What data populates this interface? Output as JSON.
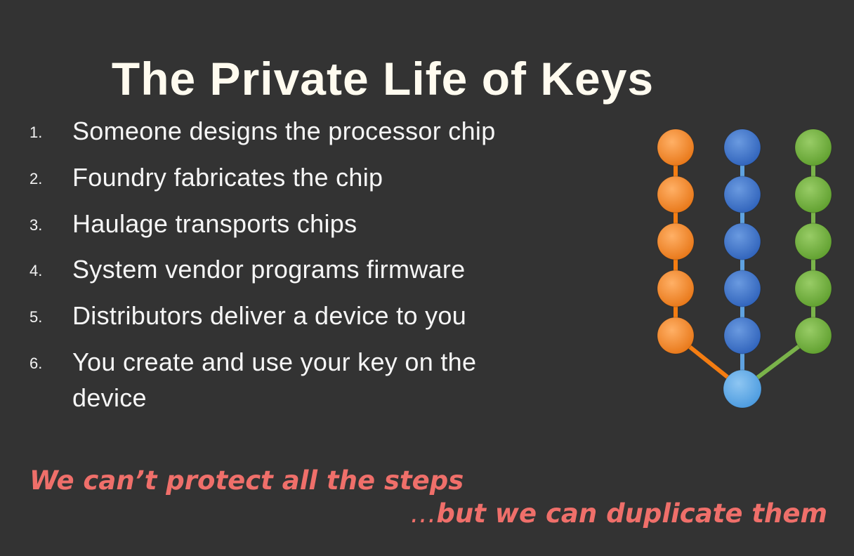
{
  "slide": {
    "title": "The Private Life of Keys",
    "steps": [
      {
        "num": "1.",
        "text": "Someone designs the processor chip"
      },
      {
        "num": "2.",
        "text": "Foundry fabricates the chip"
      },
      {
        "num": "3.",
        "text": "Haulage transports chips"
      },
      {
        "num": "4.",
        "text": "System vendor programs firmware"
      },
      {
        "num": "5.",
        "text": "Distributors deliver a device to you"
      },
      {
        "num": "6.",
        "text": "You create and use your key on the device"
      }
    ],
    "tagline_1": "We can’t protect all the steps",
    "tagline_2_ellipsis": "…",
    "tagline_2": "but we can duplicate them"
  },
  "colors": {
    "background": "#333333",
    "accent": "#ef6f6a",
    "orange": "#f08a2c",
    "blue": "#3f75c8",
    "green": "#73b140",
    "merge": "#5aa8e6"
  },
  "diagram": {
    "chains": [
      {
        "color": "orange",
        "nodes": 5
      },
      {
        "color": "blue",
        "nodes": 5
      },
      {
        "color": "green",
        "nodes": 5
      }
    ],
    "merge_node": "merge"
  }
}
